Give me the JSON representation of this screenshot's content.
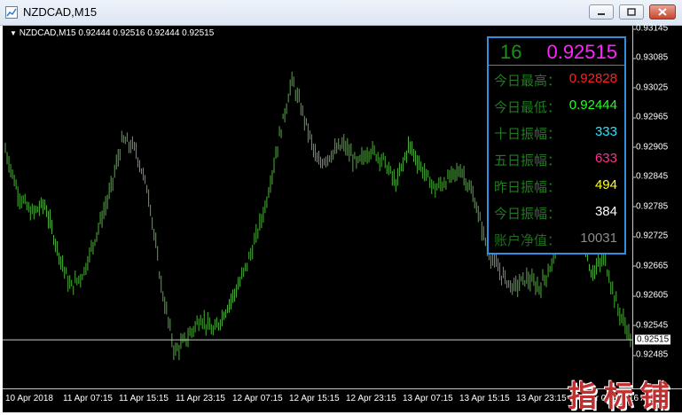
{
  "window": {
    "title": "NZDCAD,M15",
    "buttons": [
      "minimize-icon",
      "restore-icon",
      "close-icon"
    ]
  },
  "chart": {
    "header": "NZDCAD,M15  0.92444 0.92516 0.92444 0.92515",
    "bar_color": "#4caf3a",
    "background": "#000000",
    "current_price": "0.92515",
    "price_ticks": [
      "0.93145",
      "0.93085",
      "0.93025",
      "0.92965",
      "0.92905",
      "0.92845",
      "0.92785",
      "0.92725",
      "0.92665",
      "0.92605",
      "0.92545",
      "0.92485"
    ],
    "time_ticks": [
      "10 Apr 2018",
      "11 Apr 07:15",
      "11 Apr 15:15",
      "11 Apr 23:15",
      "12 Apr 07:15",
      "12 Apr 15:15",
      "12 Apr 23:15",
      "13 Apr 07:15",
      "13 Apr 15:15",
      "13 Apr 23:15",
      "16 Apr 07:15",
      "16 Apr 15"
    ]
  },
  "chart_data": {
    "type": "ohlc",
    "symbol": "NZDCAD",
    "timeframe": "M15",
    "ylim": [
      0.9243,
      0.9318
    ],
    "last_bar": {
      "open": 0.92444,
      "high": 0.92516,
      "low": 0.92444,
      "close": 0.92515
    },
    "approx_close_path": [
      0.929,
      0.9281,
      0.9277,
      0.9279,
      0.927,
      0.9262,
      0.9265,
      0.9273,
      0.9281,
      0.9292,
      0.929,
      0.9281,
      0.9262,
      0.9249,
      0.9252,
      0.9256,
      0.9253,
      0.9258,
      0.9263,
      0.927,
      0.9279,
      0.9292,
      0.9304,
      0.9296,
      0.9287,
      0.9289,
      0.9291,
      0.9287,
      0.929,
      0.9288,
      0.9283,
      0.9291,
      0.9286,
      0.9282,
      0.9284,
      0.9286,
      0.928,
      0.927,
      0.9265,
      0.9262,
      0.9264,
      0.9262,
      0.9267,
      0.9283,
      0.9276,
      0.9265,
      0.9268,
      0.9258,
      0.9252
    ]
  },
  "panel": {
    "number": "16",
    "price": "0.92515",
    "rows": [
      {
        "label": "今日最高：",
        "value": "0.92828",
        "color": "#ff2020"
      },
      {
        "label": "今日最低：",
        "value": "0.92444",
        "color": "#22ff22"
      },
      {
        "label": "十日振幅：",
        "value": "333",
        "color": "#22e5ff"
      },
      {
        "label": "五日振幅：",
        "value": "633",
        "color": "#ff2f8f"
      },
      {
        "label": "昨日振幅：",
        "value": "494",
        "color": "#ffff22"
      },
      {
        "label": "今日振幅：",
        "value": "384",
        "color": "#ffffff"
      },
      {
        "label": "账户净值：",
        "value": "10031",
        "color": "#8c8c8c"
      }
    ],
    "border_color": "#2f8fe0"
  },
  "watermark": {
    "text": "指标铺",
    "chars": [
      "指",
      "标",
      "铺"
    ]
  }
}
